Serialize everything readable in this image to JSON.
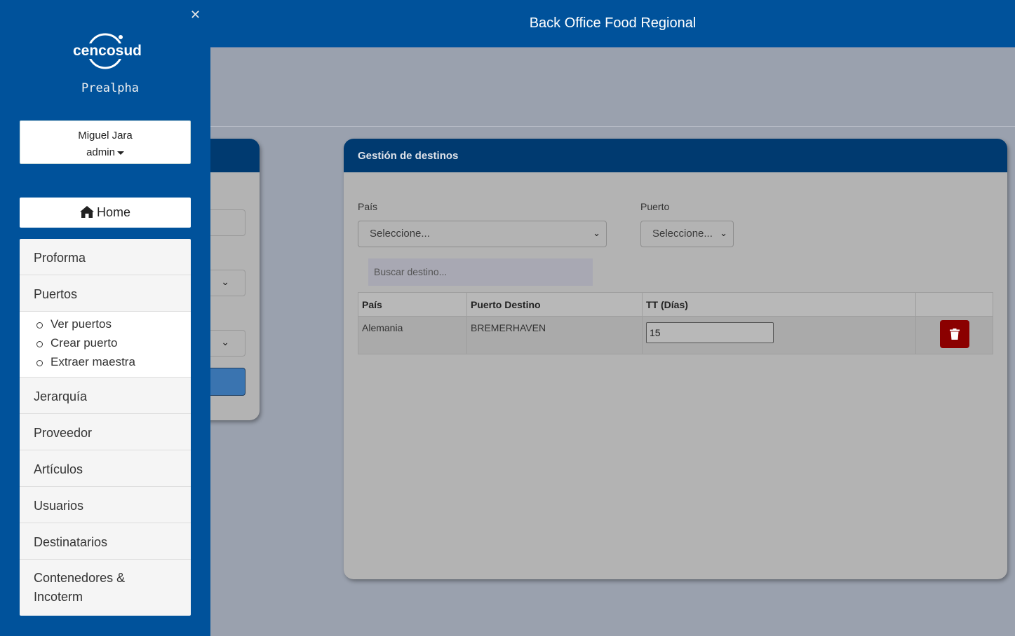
{
  "header": {
    "title": "Back Office Food Regional"
  },
  "sidebar": {
    "logo_text": "cencosud",
    "environment": "Prealpha",
    "user": {
      "name": "Miguel Jara",
      "role": "admin"
    },
    "home_label": "Home",
    "items": [
      {
        "label": "Proforma"
      },
      {
        "label": "Puertos"
      },
      {
        "label": "Jerarquía"
      },
      {
        "label": "Proveedor"
      },
      {
        "label": "Artículos"
      },
      {
        "label": "Usuarios"
      },
      {
        "label": "Destinatarios"
      },
      {
        "label": "Contenedores & Incoterm"
      }
    ],
    "puertos_sub": [
      {
        "label": "Ver puertos"
      },
      {
        "label": "Crear puerto"
      },
      {
        "label": "Extraer maestra"
      }
    ]
  },
  "destinos": {
    "title": "Gestión de destinos",
    "pais_label": "País",
    "pais_value": "Seleccione...",
    "puerto_label": "Puerto",
    "puerto_value": "Seleccione...",
    "search_placeholder": "Buscar destino...",
    "columns": [
      "País",
      "Puerto Destino",
      "TT (Días)",
      ""
    ],
    "rows": [
      {
        "pais": "Alemania",
        "puerto": "BREMERHAVEN",
        "tt": "15"
      }
    ]
  },
  "colors": {
    "primary": "#00529b",
    "header_dark": "#003a70",
    "danger": "#8b0000"
  }
}
